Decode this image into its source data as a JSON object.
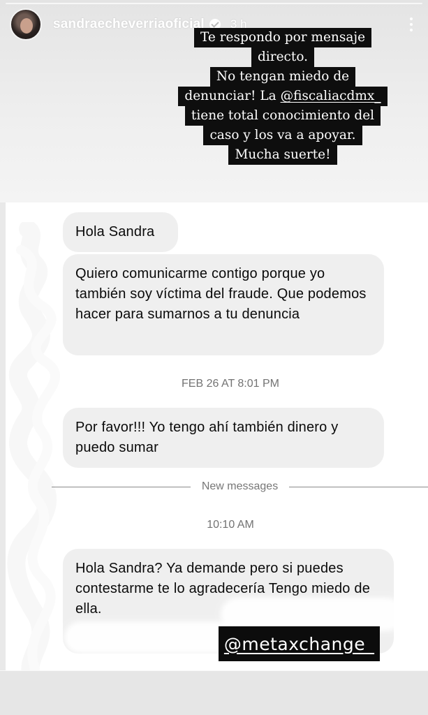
{
  "story": {
    "username": "sandraecheverriaoficial",
    "time": "3 h",
    "avatar_icon": "avatar-photo",
    "caption_lines": [
      {
        "text": "Te respondo por mensaje"
      },
      {
        "text": "directo."
      },
      {
        "text": "No tengan miedo de"
      },
      {
        "pre": "denunciar! La ",
        "mention": "@fiscaliacdmx_"
      },
      {
        "text": "tiene total conocimiento del"
      },
      {
        "text": "caso y los va a apoyar."
      },
      {
        "text": "Mucha suerte!"
      }
    ],
    "sticker_tag": "@metaxchange_"
  },
  "dm": {
    "messages": [
      {
        "text": "Hola Sandra"
      },
      {
        "text": "Quiero comunicarme contigo porque yo también soy víctima del fraude. Que podemos hacer para sumarnos a tu denuncia"
      },
      {
        "text": "Por favor!!! Yo tengo ahí también dinero y puedo sumar"
      },
      {
        "text": "Hola Sandra? Ya demande pero si puedes contestarme te lo agradecería Tengo miedo de ella."
      }
    ],
    "timestamp_1": "FEB 26 AT 8:01 PM",
    "new_messages_label": "New messages",
    "timestamp_2": "10:10 AM"
  },
  "colors": {
    "bubble": "#efefef",
    "caption_bg": "#0e0e0e",
    "timestamp": "#737373"
  }
}
